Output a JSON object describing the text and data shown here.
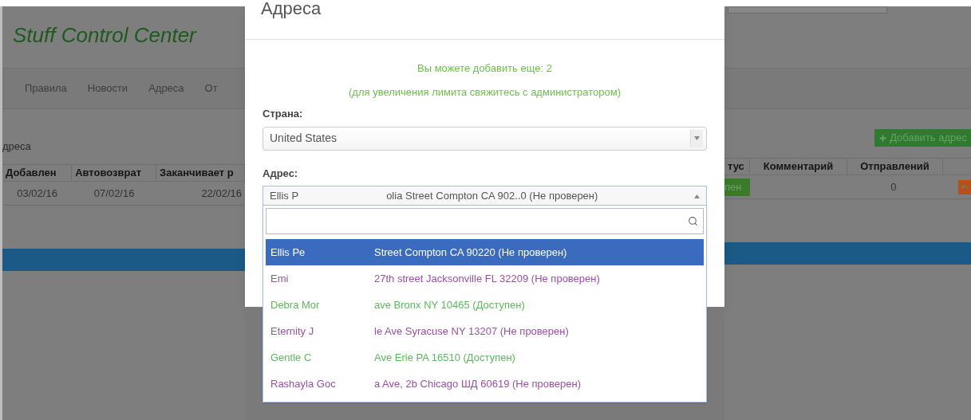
{
  "page": {
    "title": "Stuff Control Center",
    "nav": [
      {
        "label": "Правила"
      },
      {
        "label": "Новости"
      },
      {
        "label": "Адреса"
      },
      {
        "label": "От"
      }
    ],
    "section_title": "дреса",
    "add_button": "Добавить адрес",
    "table_left": {
      "columns": [
        "Добавлен",
        "Автовозврат",
        "Заканчивает р"
      ],
      "row": [
        "03/02/16",
        "07/02/16",
        "22/02/16"
      ]
    },
    "table_right": {
      "columns": [
        "тус",
        "Комментарий",
        "Отправлений"
      ],
      "status": "пен",
      "count": "0"
    }
  },
  "modal": {
    "title": "Адреса",
    "notice": "Вы можете добавить еще: 2",
    "notice_hint": "(для увеличения лимита свяжитесь с администратором)",
    "country_label": "Страна:",
    "country_value": "United States",
    "address_label": "Адрес:",
    "address_value": {
      "name": "Ellis P",
      "rest": "olia Street Compton CA 902..0 (Не проверен)"
    },
    "dropdown": {
      "expanded": true,
      "options": [
        {
          "name": "Ellis Pe",
          "rest": "Street Compton CA 90220 (Не проверен)",
          "kind": "unverified",
          "selected": true
        },
        {
          "name": "Emi",
          "rest": "27th street Jacksonville FL 32209 (Не проверен)",
          "kind": "unverified",
          "selected": false
        },
        {
          "name": "Debra Mor",
          "rest": "ave Bronx NY 10465 (Доступен)",
          "kind": "available",
          "selected": false
        },
        {
          "name": "Eternity J",
          "rest": "le Ave Syracuse NY 13207 (Не проверен)",
          "kind": "unverified",
          "selected": false
        },
        {
          "name": "Gentle C",
          "rest": "Ave Erie PA 16510 (Доступен)",
          "kind": "available",
          "selected": false
        },
        {
          "name": "Rashayla Goc",
          "rest": "a Ave, 2b Chicago ШД 60619 (Не проверен)",
          "kind": "unverified",
          "selected": false
        }
      ]
    }
  }
}
